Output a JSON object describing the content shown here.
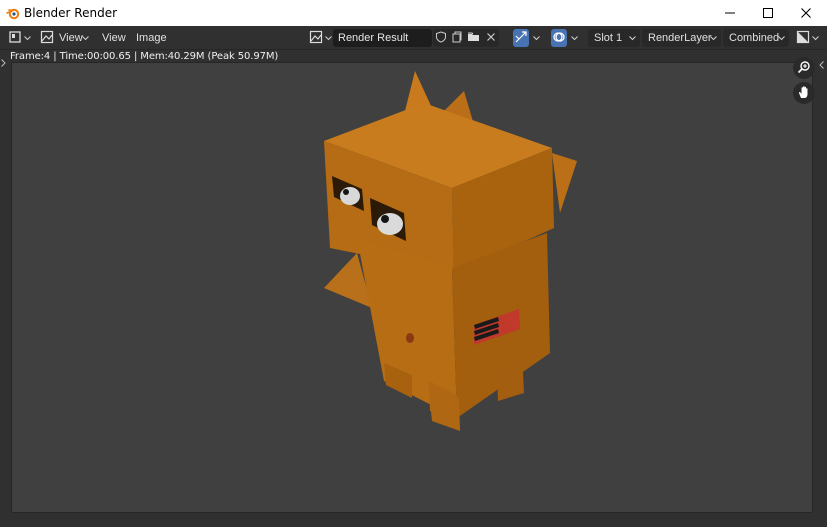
{
  "window": {
    "title": "Blender Render",
    "controls": [
      "minimize",
      "maximize",
      "close"
    ]
  },
  "header": {
    "editor_type_icon": "image-editor-icon",
    "menus": [
      "View",
      "View",
      "Image"
    ],
    "image_name": "Render Result",
    "slot": "Slot 1",
    "render_layer": "RenderLayer",
    "pass": "Combined"
  },
  "stats": {
    "text": "Frame:4 | Time:00:00.65 | Mem:40.29M (Peak 50.97M)"
  },
  "colors": {
    "accent_blue": "#4772b3",
    "background": "#303030",
    "render_bg": "#404040",
    "character_orange": "#c97a1a"
  }
}
